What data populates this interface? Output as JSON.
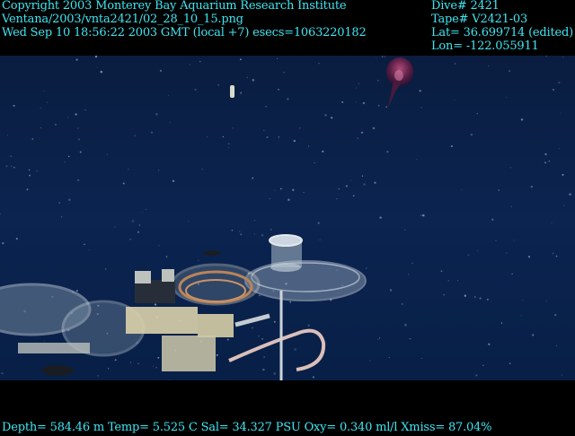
{
  "overlay_left": {
    "copyright": "Copyright 2003 Monterey Bay Aquarium Research Institute",
    "file_path": "Ventana/2003/vnta2421/02_28_10_15.png",
    "timestamp": "Wed Sep 10 18:56:22 2003 GMT (local +7)  esecs=1063220182"
  },
  "overlay_right": {
    "dive": "Dive# 2421",
    "tape": "Tape# V2421-03",
    "lat": "Lat= 36.699714 (edited)",
    "lon": "Lon= -122.055911"
  },
  "sensor_line": "Depth= 584.46 m  Temp= 5.525 C  Sal= 34.327 PSU  Oxy= 0.340 ml/l  Xmiss= 87.04%",
  "colors": {
    "overlay_text": "#3fe6f2",
    "water_top": "#0a1d40",
    "water_bottom": "#082047"
  }
}
